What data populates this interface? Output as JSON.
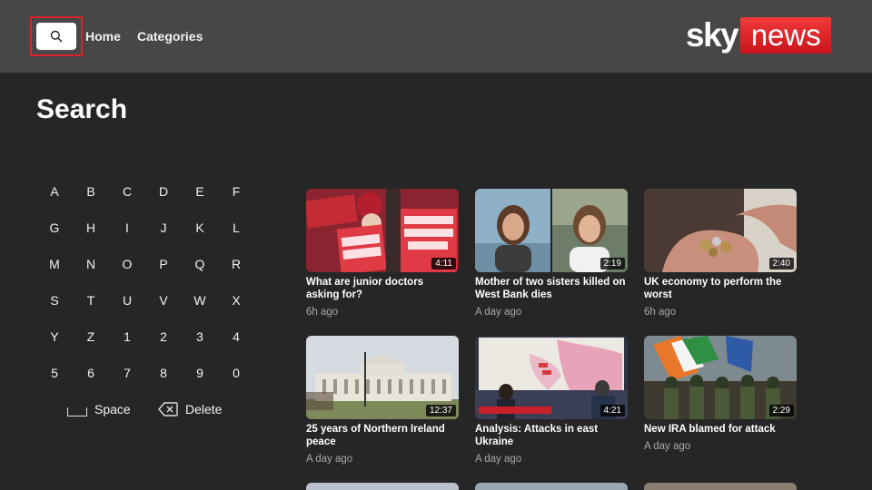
{
  "nav": {
    "home_label": "Home",
    "categories_label": "Categories"
  },
  "logo": {
    "part1": "sky",
    "part2": "news",
    "accent_color": "#d7171f"
  },
  "page": {
    "title": "Search"
  },
  "keyboard": {
    "rows": [
      [
        "A",
        "B",
        "C",
        "D",
        "E",
        "F"
      ],
      [
        "G",
        "H",
        "I",
        "J",
        "K",
        "L"
      ],
      [
        "M",
        "N",
        "O",
        "P",
        "Q",
        "R"
      ],
      [
        "S",
        "T",
        "U",
        "V",
        "W",
        "X"
      ],
      [
        "Y",
        "Z",
        "1",
        "2",
        "3",
        "4"
      ],
      [
        "5",
        "6",
        "7",
        "8",
        "9",
        "0"
      ]
    ],
    "space_label": "Space",
    "delete_label": "Delete"
  },
  "results": [
    {
      "title": "What are junior doctors asking for?",
      "time": "6h ago",
      "duration": "4:11"
    },
    {
      "title": "Mother of two sisters killed on West Bank dies",
      "time": "A day ago",
      "duration": "2:19"
    },
    {
      "title": "UK economy to perform the worst",
      "time": "6h ago",
      "duration": "2:40"
    },
    {
      "title": "25 years of Northern Ireland peace",
      "time": "A day ago",
      "duration": "12:37"
    },
    {
      "title": "Analysis: Attacks in east Ukraine",
      "time": "A day ago",
      "duration": "4:21"
    },
    {
      "title": "New IRA blamed for attack",
      "time": "A day ago",
      "duration": "2:29"
    }
  ]
}
